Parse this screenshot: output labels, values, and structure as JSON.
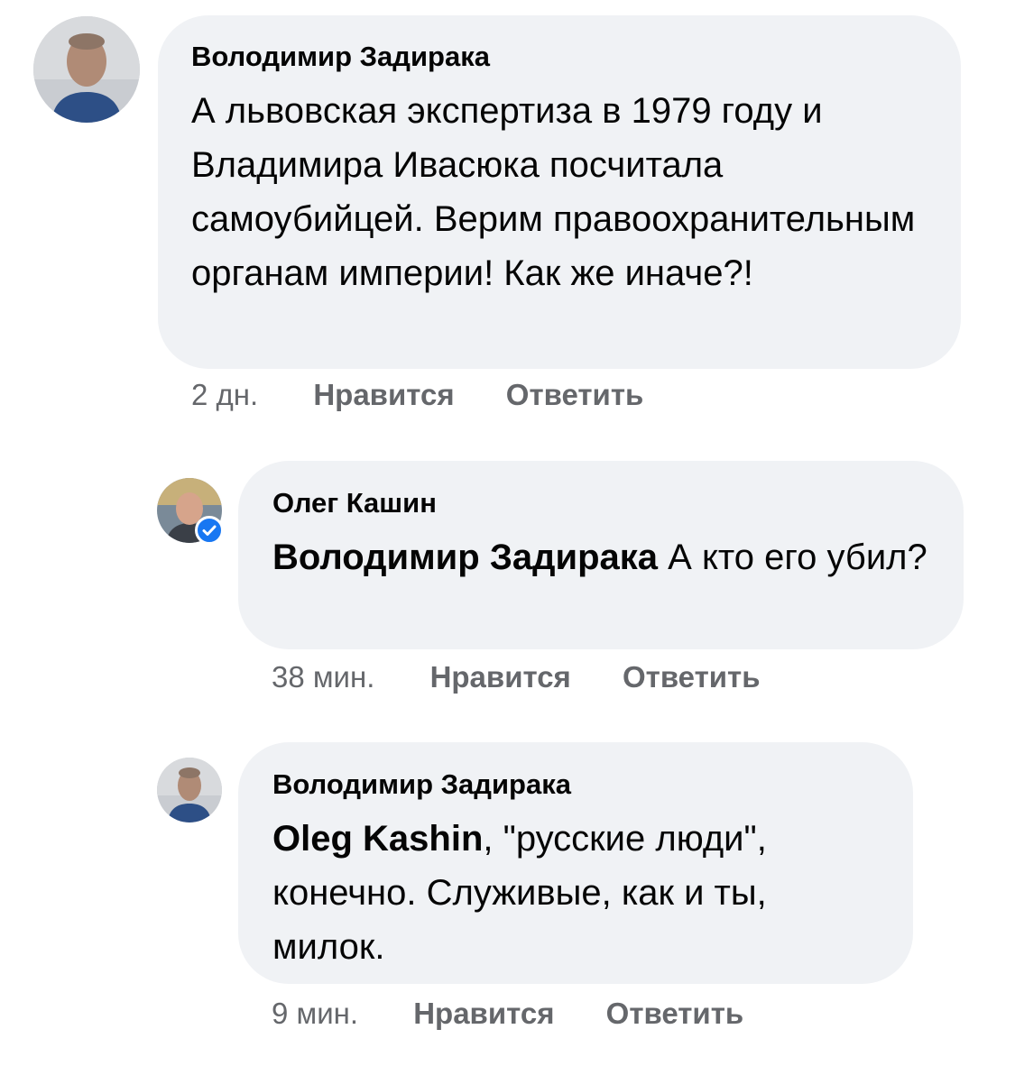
{
  "comments": [
    {
      "author": "Володимир Задирака",
      "text": "А львовская экспертиза в 1979 году и Владимира Ивасюка посчитала самоубийцей. Верим правоохранительным органам империи! Как же иначе?!",
      "time": "2 дн.",
      "like_label": "Нравится",
      "reply_label": "Ответить",
      "avatar_icon": "user-avatar-photo"
    },
    {
      "author": "Олег Кашин",
      "mention": "Володимир Задирака",
      "text": " А кто его убил?",
      "time": "38 мин.",
      "like_label": "Нравится",
      "reply_label": "Ответить",
      "avatar_icon": "user-avatar-photo",
      "badge_icon": "verified-check-icon"
    },
    {
      "author": "Володимир Задирака",
      "mention": "Oleg Kashin",
      "text": ", \"русские люди\", конечно. Служивые, как и ты, милок.",
      "time": "9 мин.",
      "like_label": "Нравится",
      "reply_label": "Ответить",
      "avatar_icon": "user-avatar-photo"
    }
  ],
  "colors": {
    "bubble": "#f0f2f5",
    "text": "#050505",
    "meta": "#65676b",
    "verified": "#1877f2"
  }
}
